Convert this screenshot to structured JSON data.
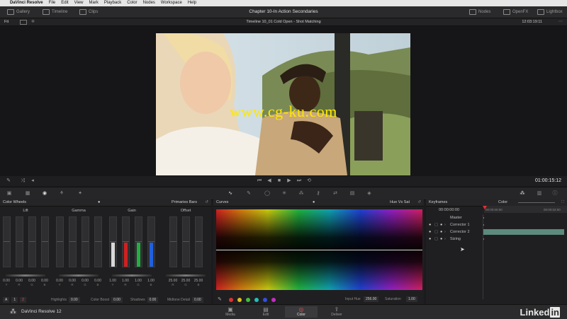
{
  "menubar": {
    "app": "DaVinci Resolve",
    "items": [
      "File",
      "Edit",
      "View",
      "Mark",
      "Playback",
      "Color",
      "Nodes",
      "Workspace",
      "Help"
    ]
  },
  "topbar": {
    "left_buttons": [
      "Gallery",
      "Timeline",
      "Clips"
    ],
    "project_title": "Chapter 10-In Action Secondaries",
    "right_buttons": [
      "Nodes",
      "OpenFX",
      "Lightbox"
    ]
  },
  "viewer": {
    "fit_label": "Fit",
    "timeline_name": "Timeline 10_01 Cold Open - Shot Matching",
    "timecode_top": "12:03:19:11",
    "watermark": "www.cg-ku.com",
    "timecode": "01:00:15:12"
  },
  "color_wheels": {
    "title": "Color Wheels",
    "mode": "Primaries Bars",
    "groups": [
      {
        "name": "Lift",
        "values": [
          "0.00",
          "0.00",
          "0.00",
          "0.00"
        ]
      },
      {
        "name": "Gamma",
        "values": [
          "0.00",
          "0.00",
          "0.00",
          "0.00"
        ]
      },
      {
        "name": "Gain",
        "values": [
          "1.00",
          "1.00",
          "1.00",
          "1.00"
        ]
      },
      {
        "name": "Offset",
        "values": [
          "25.00",
          "25.00",
          "25.00"
        ]
      }
    ],
    "channels4": [
      "Y",
      "R",
      "G",
      "B"
    ],
    "channels3": [
      "R",
      "G",
      "B"
    ],
    "footer": {
      "mode_a": "A",
      "page_1": "1",
      "page_2": "2",
      "highlights_label": "Highlights",
      "highlights_value": "0.00",
      "color_boost_label": "Color Boost",
      "color_boost_value": "0.00",
      "shadows_label": "Shadows",
      "shadows_value": "0.00",
      "midtone_detail_label": "Midtone Detail",
      "midtone_detail_value": "0.00"
    }
  },
  "curves": {
    "title": "Curves",
    "mode": "Hue Vs Sat",
    "input_hue_label": "Input Hue",
    "input_hue_value": "256.00",
    "saturation_label": "Saturation",
    "saturation_value": "1.00",
    "swatches": [
      "#e03030",
      "#e0c020",
      "#40c040",
      "#20c0c0",
      "#3050e0",
      "#c030c0"
    ]
  },
  "keyframes": {
    "title": "Keyframes",
    "mode": "Color",
    "timecode": "00:00:00:00",
    "ruler_start": "00:00:00:00",
    "ruler_end": "00:00:02:00",
    "rows": [
      "Master",
      "Corrector 1",
      "Corrector 2",
      "Sizing"
    ]
  },
  "pages": [
    {
      "label": "Media"
    },
    {
      "label": "Edit"
    },
    {
      "label": "Color"
    },
    {
      "label": "Deliver"
    }
  ],
  "app_label": "DaVinci Resolve 12",
  "logo": {
    "text_a": "Linked",
    "text_b": "in"
  }
}
